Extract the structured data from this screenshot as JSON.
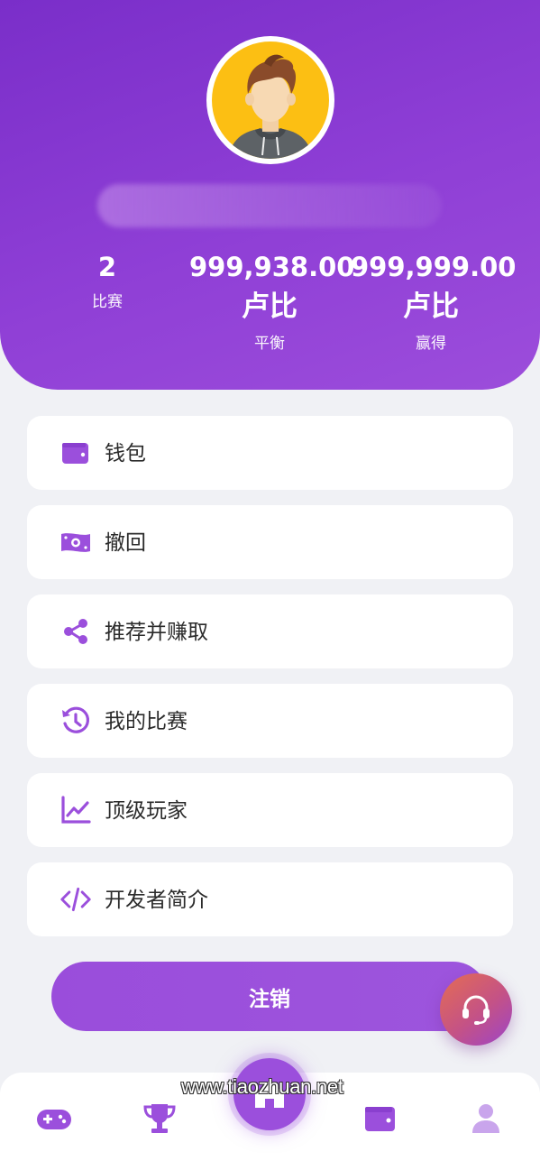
{
  "profile": {
    "avatar_icon": "user-avatar-illustration"
  },
  "stats": {
    "matches": {
      "value": "2",
      "label": "比赛"
    },
    "balance": {
      "value": "999,938.00",
      "unit": "卢比",
      "label": "平衡"
    },
    "earned": {
      "value": "999,999.00",
      "unit": "卢比",
      "label": "赢得"
    }
  },
  "menu": [
    {
      "label": "钱包",
      "icon": "wallet-icon"
    },
    {
      "label": "撤回",
      "icon": "money-bill-icon"
    },
    {
      "label": "推荐并赚取",
      "icon": "share-icon"
    },
    {
      "label": "我的比赛",
      "icon": "history-icon"
    },
    {
      "label": "顶级玩家",
      "icon": "chart-line-icon"
    },
    {
      "label": "开发者简介",
      "icon": "code-icon"
    }
  ],
  "logout_label": "注销",
  "support_icon": "headset-icon",
  "bottom_nav": [
    {
      "icon": "gamepad-icon"
    },
    {
      "icon": "trophy-icon"
    },
    {
      "icon": "home-icon"
    },
    {
      "icon": "wallet-icon"
    },
    {
      "icon": "user-icon"
    }
  ],
  "watermark": "www.tiaozhuan.net",
  "colors": {
    "primary": "#9b4fdc",
    "header_start": "#7a2ec9",
    "header_end": "#9c4ddb",
    "background": "#f0f1f5",
    "support_start": "#e56d52",
    "support_end": "#9c44c9"
  }
}
